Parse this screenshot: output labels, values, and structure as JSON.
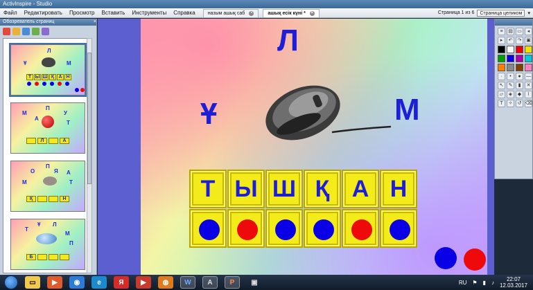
{
  "window": {
    "title": "ActivInspire - Studio"
  },
  "menu": [
    "Файл",
    "Редактировать",
    "Просмотр",
    "Вставить",
    "Инструменты",
    "Справка"
  ],
  "tabs": [
    {
      "label": "назым ашық саб"
    },
    {
      "label": "ашық есік күні *"
    }
  ],
  "page_info": {
    "label": "Страница 1 из 6",
    "zoom": "Страница целиком"
  },
  "browser": {
    "title": "Обозреватель страниц"
  },
  "thumbnails": [
    {
      "letters": [
        "Л",
        "Ұ",
        "М"
      ],
      "cells": [
        "Т",
        "Ы",
        "Ш",
        "Қ",
        "А",
        "Н"
      ]
    },
    {
      "letters": [
        "П",
        "М",
        "А",
        "У",
        "Т"
      ],
      "cells": [
        "",
        "Л",
        "",
        "А"
      ]
    },
    {
      "letters": [
        "П",
        "О",
        "Я",
        "М",
        "А",
        "Т"
      ],
      "cells": [
        "Қ",
        "",
        "",
        "Н"
      ]
    },
    {
      "letters": [
        "Ұ",
        "Т",
        "Л",
        "М",
        "П"
      ],
      "cells": [
        "Б",
        "",
        "",
        ""
      ]
    }
  ],
  "slide": {
    "letters": {
      "top": "Л",
      "left": "Ұ",
      "right": "М"
    },
    "word": [
      "Т",
      "Ы",
      "Ш",
      "Қ",
      "А",
      "Н"
    ],
    "dots": [
      "blue",
      "red",
      "blue",
      "blue",
      "red",
      "blue"
    ],
    "legend": [
      "blue",
      "red"
    ],
    "colors": {
      "blue": "#0a00e6",
      "red": "#ee0a0a",
      "tile": "#f4ec1a",
      "letter": "#1e1ed8"
    }
  },
  "tray": {
    "lang": "RU",
    "time": "22:07",
    "date": "12.03.2017"
  }
}
